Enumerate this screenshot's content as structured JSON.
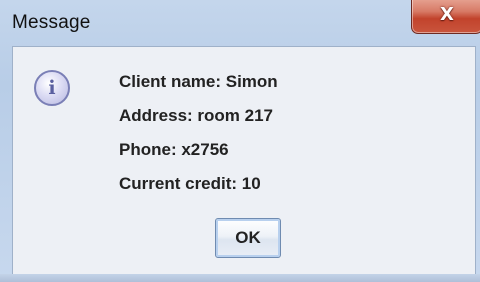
{
  "window": {
    "title": "Message",
    "close_symbol": "X"
  },
  "icon": {
    "name": "info-icon",
    "glyph": "i"
  },
  "message": {
    "lines": [
      "Client name: Simon",
      "Address: room 217",
      "Phone: x2756",
      "Current credit: 10"
    ]
  },
  "buttons": {
    "ok_label": "OK"
  }
}
